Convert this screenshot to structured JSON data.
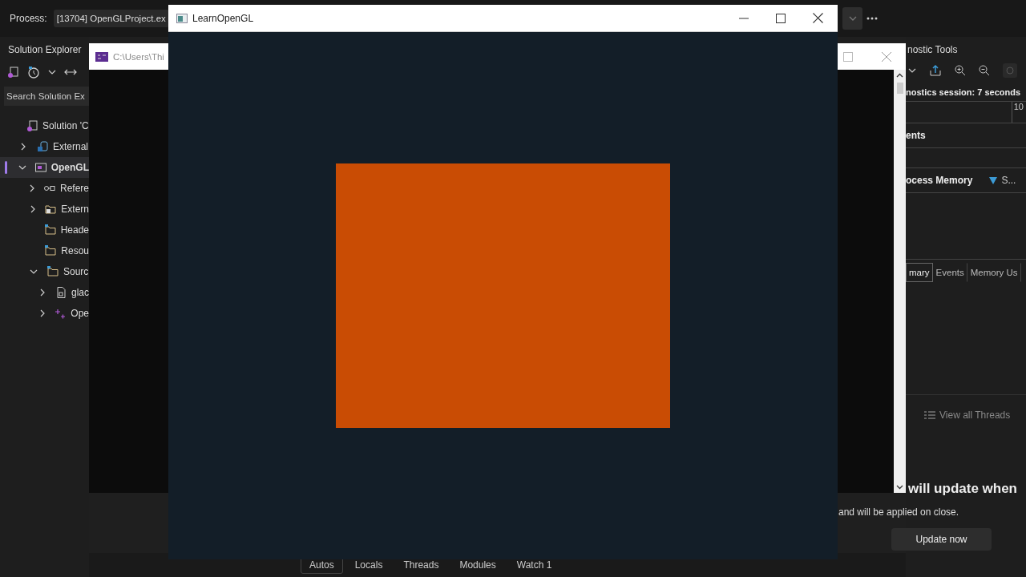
{
  "ide": {
    "process_label": "Process:",
    "process_value": "[13704] OpenGLProject.ex"
  },
  "solution_explorer": {
    "title": "Solution Explorer",
    "search": {
      "placeholder": "Search Solution Ex"
    },
    "tree": [
      {
        "label": "Solution 'C",
        "kind": "solution",
        "selected": false,
        "children": [
          {
            "label": "External",
            "kind": "external",
            "expanded": false,
            "selected": false
          },
          {
            "label": "OpenGL",
            "kind": "project",
            "expanded": true,
            "selected": true,
            "children": [
              {
                "label": "Refere",
                "kind": "references",
                "expanded": false,
                "selected": false
              },
              {
                "label": "Extern",
                "kind": "external-deps",
                "expanded": false,
                "selected": false
              },
              {
                "label": "Heade",
                "kind": "folder",
                "selected": false
              },
              {
                "label": "Resou",
                "kind": "folder",
                "selected": false
              },
              {
                "label": "Sourc",
                "kind": "folder",
                "expanded": true,
                "selected": false,
                "children": [
                  {
                    "label": "glac",
                    "kind": "c-file",
                    "expanded": false,
                    "selected": false
                  },
                  {
                    "label": "Ope",
                    "kind": "cpp-file",
                    "expanded": false,
                    "selected": false
                  }
                ]
              }
            ]
          }
        ]
      }
    ]
  },
  "diagnostics": {
    "title": "nostic Tools",
    "session": "nostics session: 7 seconds",
    "ruler_label": "10",
    "events_heading": "ents",
    "memory_heading": "ocess Memory",
    "legend": "S...",
    "tabs": [
      {
        "label": "mary",
        "selected": true
      },
      {
        "label": "Events",
        "selected": false
      },
      {
        "label": "Memory Us",
        "selected": false
      }
    ],
    "threads_button": "View all Threads"
  },
  "notification": {
    "title": "will update when",
    "message": "and will be applied on close.",
    "button": "Update now"
  },
  "bottom_tabs": [
    {
      "label": "Autos",
      "selected": true
    },
    {
      "label": "Locals",
      "selected": false
    },
    {
      "label": "Threads",
      "selected": false
    },
    {
      "label": "Modules",
      "selected": false
    },
    {
      "label": "Watch 1",
      "selected": false
    }
  ],
  "console_window": {
    "title": "C:\\Users\\Thi"
  },
  "gl_window": {
    "title": "LearnOpenGL"
  }
}
